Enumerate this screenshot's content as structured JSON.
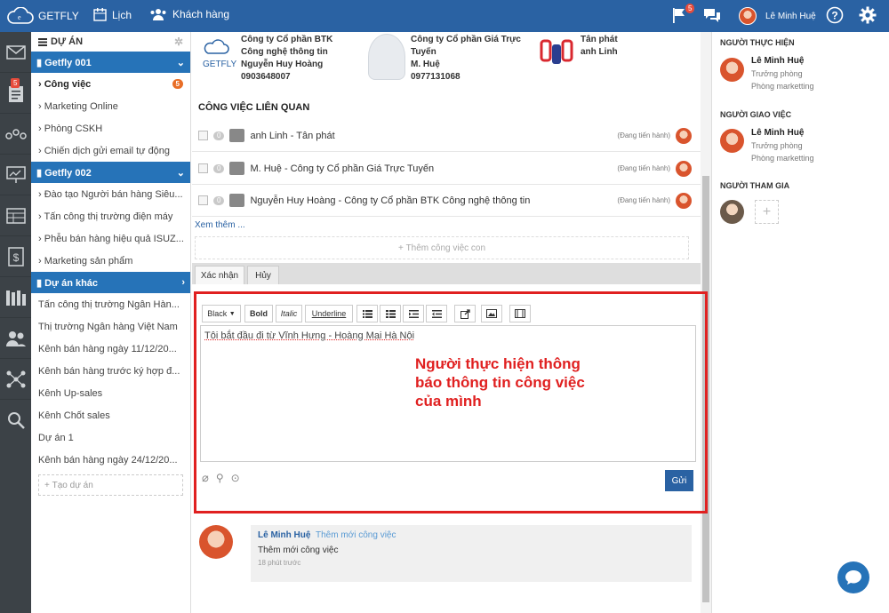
{
  "topbar": {
    "logo": "GETFLY",
    "nav_calendar": "Lịch",
    "nav_customers": "Khách hàng",
    "notif_count": "5",
    "user_name": "Lê Minh Huệ"
  },
  "iconbar": {
    "mail_badge": "5"
  },
  "sidebar": {
    "title": "DỰ ÁN",
    "group1": "Getfly 001",
    "group1_items": [
      {
        "label": "Công việc",
        "badge": "5"
      },
      {
        "label": "Marketing Online"
      },
      {
        "label": "Phòng CSKH"
      },
      {
        "label": "Chiến dịch gửi email tự động"
      }
    ],
    "group2": "Getfly 002",
    "group2_items": [
      "Đào tạo Người bán hàng Siêu...",
      "Tấn công thị trường điện máy",
      "Phễu bán hàng hiệu quả ISUZ...",
      "Marketing sản phẩm"
    ],
    "group3": "Dự án khác",
    "group3_items": [
      "Tấn công thị trường Ngân Hàn...",
      "Thị trường Ngân hàng Việt Nam",
      "Kênh bán hàng ngày 11/12/20...",
      "Kênh bán hàng trước ký hợp đ...",
      "Kênh Up-sales",
      "Kênh Chốt sales",
      "Dự án 1",
      "Kênh bán hàng ngày 24/12/20..."
    ],
    "create_project": "Tạo dự án"
  },
  "companies": [
    {
      "name1": "Công ty Cổ phần BTK",
      "name2": "Công nghệ thông tin",
      "contact": "Nguyễn Huy Hoàng",
      "phone": "0903648007",
      "logo_text": "GETFLY"
    },
    {
      "name1": "Công ty Cổ phần Giá Trực",
      "name2": "Tuyến",
      "contact": "M. Huệ",
      "phone": "0977131068"
    },
    {
      "name1": "Tân phát",
      "contact": "anh Linh"
    }
  ],
  "related": {
    "title": "CÔNG VIỆC LIÊN QUAN",
    "tasks": [
      {
        "count": "0",
        "name": "anh Linh - Tân phát",
        "status": "(Đang tiến hành)"
      },
      {
        "count": "0",
        "name": "M. Huệ - Công ty Cổ phần Giá Trực Tuyến",
        "status": "(Đang tiến hành)"
      },
      {
        "count": "0",
        "name": "Nguyễn Huy Hoàng - Công ty Cổ phần BTK Công nghệ thông tin",
        "status": "(Đang tiến hành)"
      }
    ],
    "more": "Xem thêm ...",
    "add_sub": "Thêm công việc con"
  },
  "tabs": {
    "confirm": "Xác nhận",
    "cancel": "Hủy"
  },
  "editor": {
    "color": "Black",
    "bold": "Bold",
    "italic": "Italic",
    "underline": "Underline",
    "content": "Tôi bắt đầu đi từ Vĩnh Hưng - Hoàng Mai Hà Nội",
    "send": "Gửi",
    "annotation": [
      "Người thực hiện thông",
      "báo thông tin công việc",
      "của mình"
    ],
    "colors": {
      "annotation": "#e02020",
      "frame": "#e02020",
      "send_bg": "#2a62a3"
    }
  },
  "activity": {
    "user": "Lê Minh Huệ",
    "action": "Thêm mới công việc",
    "text": "Thêm mới công việc",
    "time": "18 phút trước"
  },
  "right": {
    "performer_title": "NGƯỜI THỰC HIỆN",
    "performer": {
      "name": "Lê Minh Huệ",
      "role": "Trưởng phòng",
      "dept": "Phòng marketting"
    },
    "assigner_title": "NGƯỜI GIAO VIỆC",
    "assigner": {
      "name": "Lê Minh Huệ",
      "role": "Trưởng phòng",
      "dept": "Phòng marketting"
    },
    "participants_title": "NGƯỜI THAM GIA"
  }
}
